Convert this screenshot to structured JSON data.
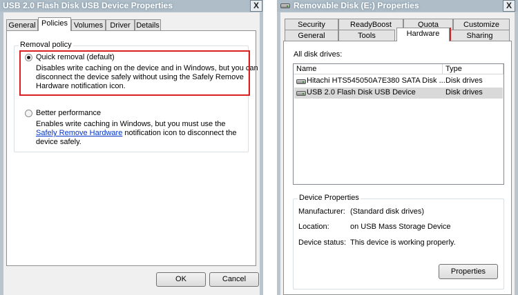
{
  "left_window": {
    "title": "USB 2.0 Flash Disk USB Device Properties",
    "close_glyph": "X",
    "tabs": [
      "General",
      "Policies",
      "Volumes",
      "Driver",
      "Details"
    ],
    "group_title": "Removal policy",
    "quick_removal": {
      "label": "Quick removal (default)",
      "desc_line1": "Disables write caching on the device and in Windows, but you can",
      "desc_line2": "disconnect the device safely without using the Safely Remove",
      "desc_line3": "Hardware notification icon.",
      "selected": true
    },
    "better_performance": {
      "label": "Better performance",
      "desc_line1": "Enables write caching in Windows, but you must use the",
      "link": "Safely Remove Hardware",
      "desc_line2_rest": " notification icon to disconnect the",
      "desc_line3": "device safely.",
      "selected": false
    },
    "ok_label": "OK",
    "cancel_label": "Cancel"
  },
  "right_window": {
    "title": "Removable Disk (E:) Properties",
    "close_glyph": "X",
    "tabs_back": [
      "Security",
      "ReadyBoost",
      "Quota",
      "Customize"
    ],
    "tabs_front": [
      "General",
      "Tools",
      "Hardware",
      "Sharing"
    ],
    "all_disk_drives_label": "All disk drives:",
    "columns": [
      "Name",
      "Type"
    ],
    "drives": [
      {
        "name": "Hitachi HTS545050A7E380 SATA Disk ...",
        "type": "Disk drives",
        "selected": false
      },
      {
        "name": "USB 2.0 Flash Disk USB Device",
        "type": "Disk drives",
        "selected": true
      }
    ],
    "device_properties": {
      "title": "Device Properties",
      "manufacturer_label": "Manufacturer:",
      "manufacturer_value": "(Standard disk drives)",
      "location_label": "Location:",
      "location_value": "on USB Mass Storage Device",
      "status_label": "Device status:",
      "status_value": "This device is working properly."
    },
    "properties_button": "Properties"
  },
  "colors": {
    "highlight_box": "#d92020",
    "window_frame": "#b9c4cc",
    "link": "#0033cc"
  }
}
